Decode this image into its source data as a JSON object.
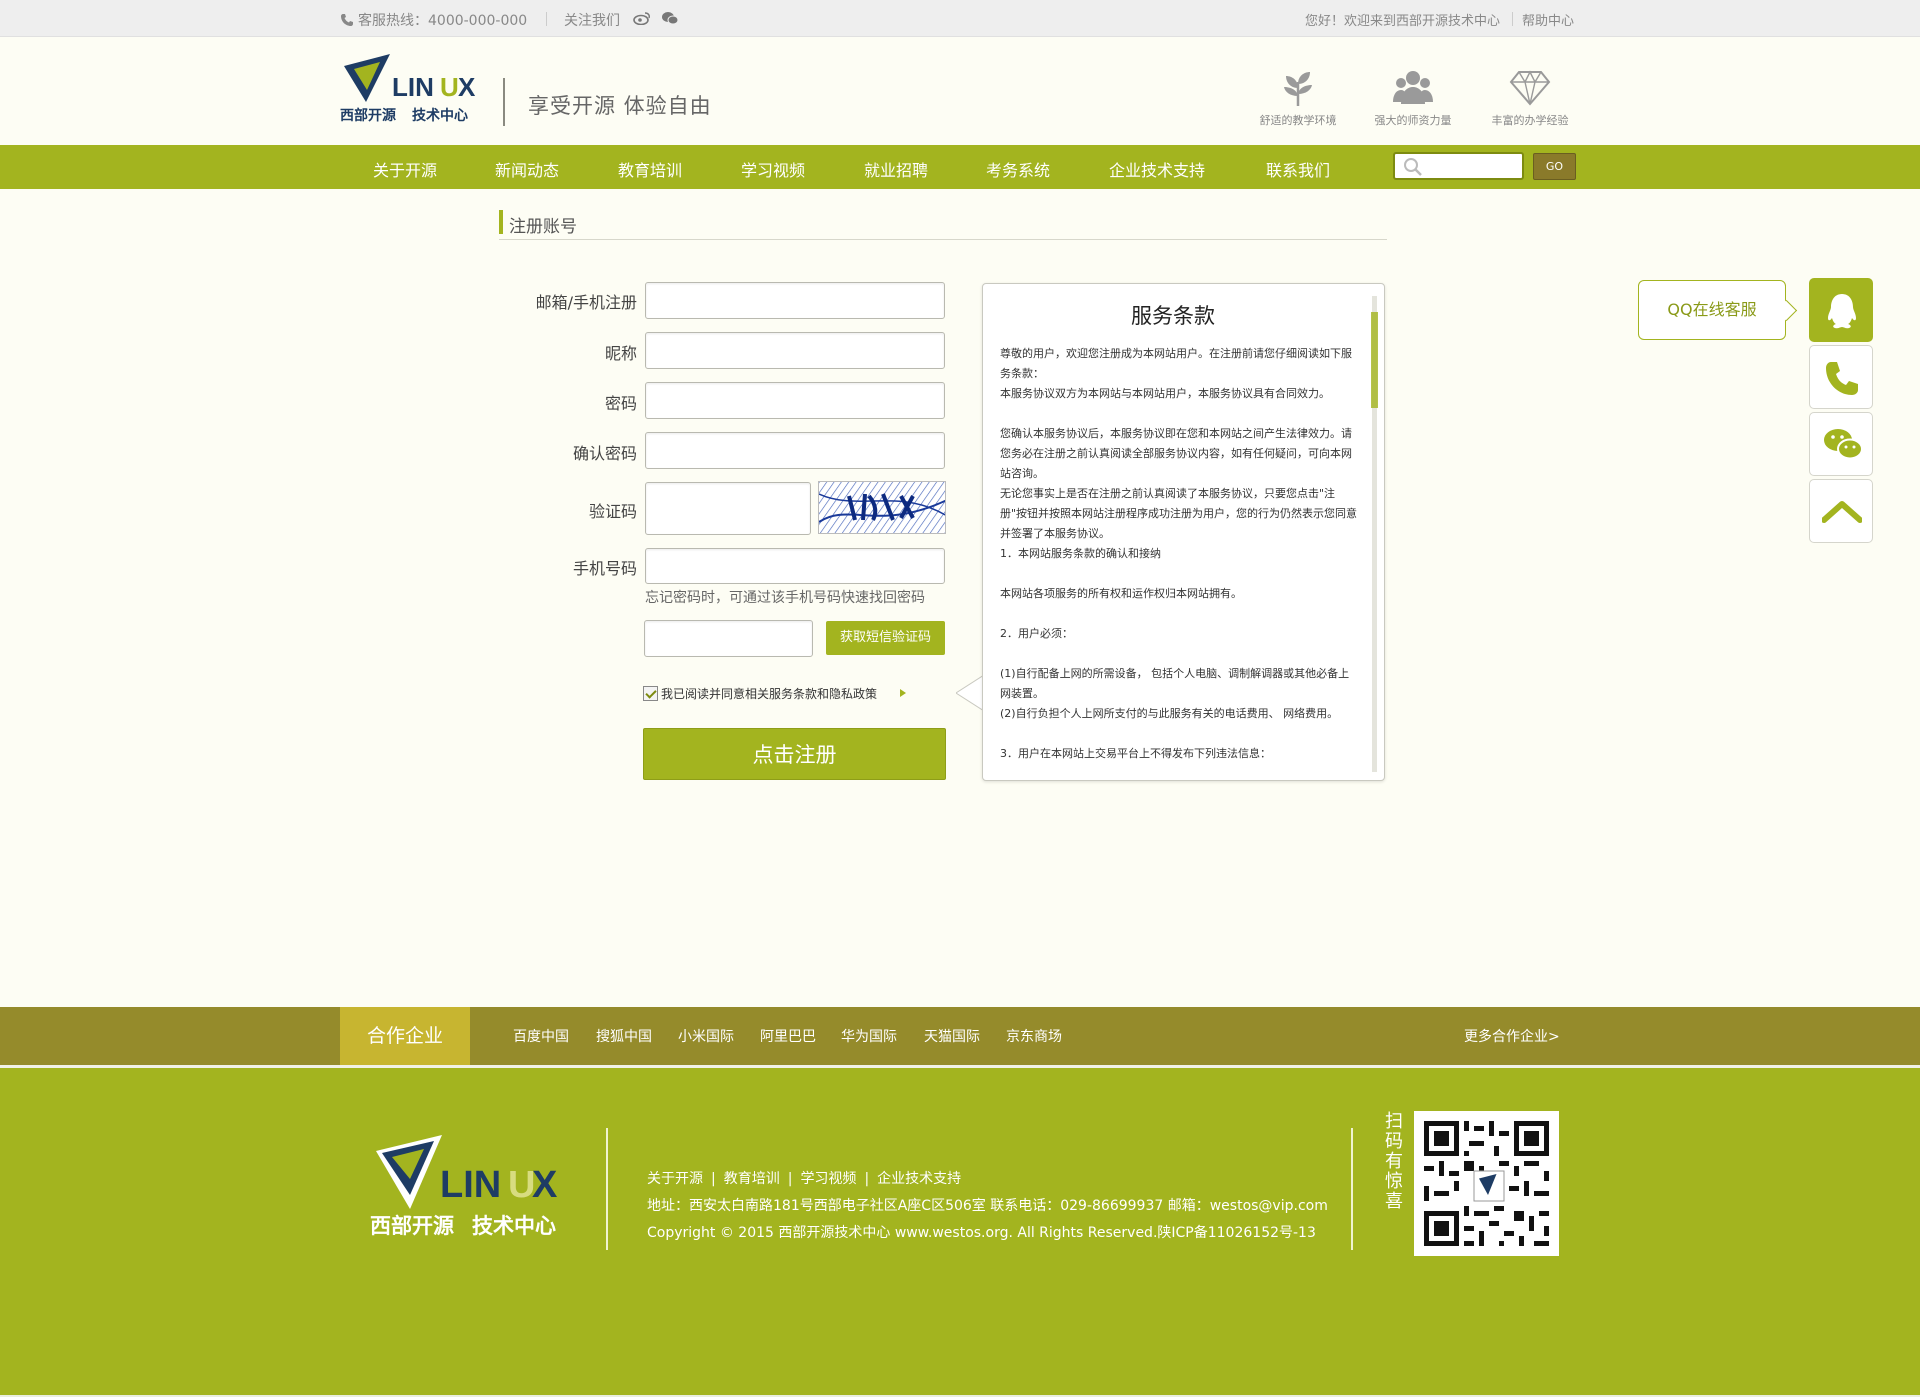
{
  "topbar": {
    "hotline": "客服热线：4000-000-000",
    "follow": "关注我们",
    "welcome": "您好！欢迎来到西部开源技术中心",
    "help": "帮助中心"
  },
  "header": {
    "logo_text": "LINUX",
    "logo_sub": "西部开源技术中心",
    "slogan": "享受开源  体验自由",
    "features": [
      "舒适的教学环境",
      "强大的师资力量",
      "丰富的办学经验"
    ]
  },
  "nav": {
    "items": [
      "关于开源",
      "新闻动态",
      "教育培训",
      "学习视频",
      "就业招聘",
      "考务系统",
      "企业技术支持",
      "联系我们"
    ],
    "search_placeholder": "",
    "go": "GO"
  },
  "section": {
    "title": "注册账号"
  },
  "form": {
    "email_label": "邮箱/手机注册",
    "nickname_label": "昵称",
    "password_label": "密码",
    "confirm_label": "确认密码",
    "captcha_label": "验证码",
    "phone_label": "手机号码",
    "phone_hint": "忘记密码时，可通过该手机号码快速找回密码",
    "sms_button": "获取短信验证码",
    "agree_text": "我已阅读并同意相关服务条款和隐私政策",
    "submit": "点击注册"
  },
  "terms": {
    "title": "服务条款",
    "paragraphs": [
      "尊敬的用户，欢迎您注册成为本网站用户。在注册前请您仔细阅读如下服务条款：",
      "本服务协议双方为本网站与本网站用户，本服务协议具有合同效力。",
      "",
      "您确认本服务协议后，本服务协议即在您和本网站之间产生法律效力。请您务必在注册之前认真阅读全部服务协议内容，如有任何疑问，可向本网站咨询。",
      "无论您事实上是否在注册之前认真阅读了本服务协议，只要您点击\"注册\"按钮并按照本网站注册程序成功注册为用户，您的行为仍然表示您同意并签署了本服务协议。",
      "1．本网站服务条款的确认和接纳",
      "",
      "本网站各项服务的所有权和运作权归本网站拥有。",
      "",
      "2．用户必须：",
      "",
      "(1)自行配备上网的所需设备， 包括个人电脑、调制解调器或其他必备上网装置。",
      "(2)自行负担个人上网所支付的与此服务有关的电话费用、 网络费用。",
      "",
      "3．用户在本网站上交易平台上不得发布下列违法信息："
    ]
  },
  "side": {
    "qq_tip": "QQ在线客服"
  },
  "partners": {
    "title": "合作企业",
    "links": [
      "百度中国",
      "搜狐中国",
      "小米国际",
      "阿里巴巴",
      "华为国际",
      "天猫国际",
      "京东商场"
    ],
    "more": "更多合作企业>"
  },
  "footer": {
    "links": [
      "关于开源",
      "教育培训",
      "学习视频",
      "企业技术支持"
    ],
    "address": "地址：西安太白南路181号西部电子社区A座C区506室    联系电话：029-86699937   邮箱：westos@vip.com",
    "copyright": "Copyright © 2015 西部开源技术中心 www.westos.org. All Rights Reserved.陕ICP备11026152号-13",
    "scan": "扫码有惊喜"
  },
  "colors": {
    "accent": "#a3b41f",
    "partner_bar": "#958b2b",
    "partner_title": "#c7b530"
  }
}
